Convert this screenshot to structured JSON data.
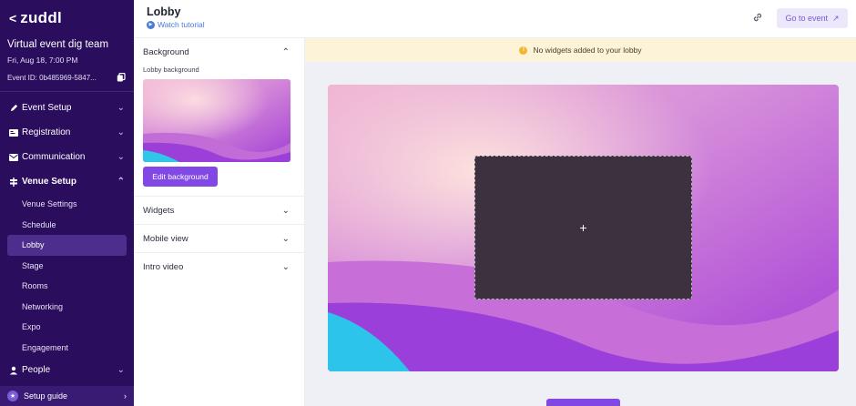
{
  "sidebar": {
    "logo_back": "<",
    "logo_text": "zuddl",
    "event_name": "Virtual event dig team",
    "event_date": "Fri, Aug 18, 7:00 PM",
    "event_id": "Event ID: 0b485969-5847...",
    "nav": [
      {
        "label": "Event Setup",
        "icon": "pen-icon"
      },
      {
        "label": "Registration",
        "icon": "id-card-icon"
      },
      {
        "label": "Communication",
        "icon": "mail-icon"
      },
      {
        "label": "Venue Setup",
        "icon": "signpost-icon"
      }
    ],
    "venue_sub": [
      "Venue Settings",
      "Schedule",
      "Lobby",
      "Stage",
      "Rooms",
      "Networking",
      "Expo",
      "Engagement"
    ],
    "people": "People",
    "setup_guide": "Setup guide"
  },
  "header": {
    "title": "Lobby",
    "watch_tutorial": "Watch tutorial",
    "go_to_event": "Go to event"
  },
  "panel": {
    "background_title": "Background",
    "lobby_background_label": "Lobby background",
    "edit_background": "Edit background",
    "widgets": "Widgets",
    "mobile_view": "Mobile view",
    "intro_video": "Intro video"
  },
  "main": {
    "banner": "No widgets added to your lobby",
    "add_symbol": "+"
  },
  "colors": {
    "sidebar_bg": "#2a0d5c",
    "accent": "#8148e6",
    "banner_bg": "#fdf3d8"
  }
}
